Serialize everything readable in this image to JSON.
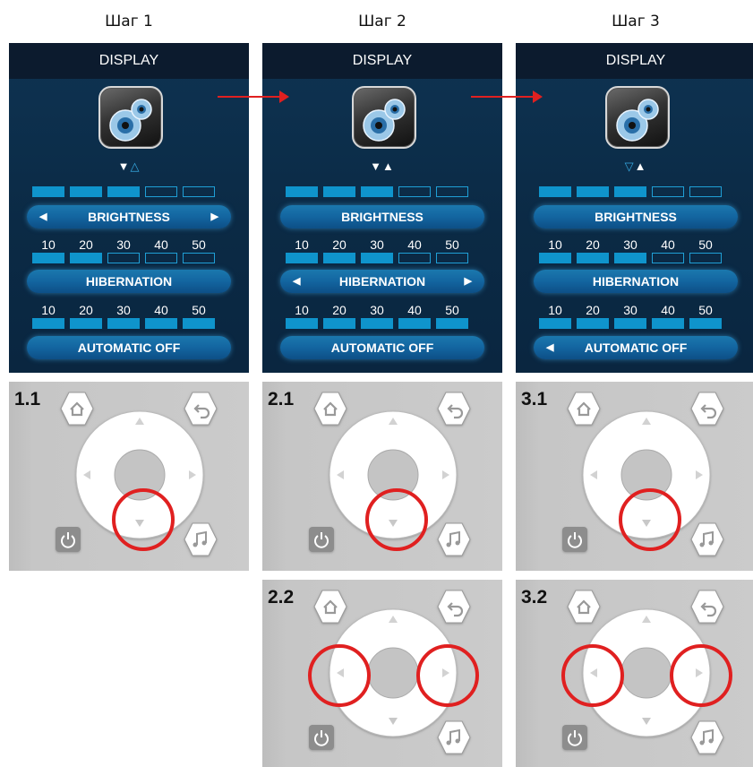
{
  "steps": [
    {
      "title": "Шаг 1",
      "screen": {
        "header": "DISPLAY",
        "arrow_left": "▼",
        "arrow_right": "△",
        "brightness": {
          "label": "BRIGHTNESS",
          "selected": true,
          "level": 3,
          "total": 5
        },
        "hibernation": {
          "label": "HIBERNATION",
          "selected": false,
          "level": 2,
          "total": 5,
          "values": [
            "10",
            "20",
            "30",
            "40",
            "50"
          ]
        },
        "automatic_off": {
          "label": "AUTOMATIC OFF",
          "selected": false,
          "level": 5,
          "total": 5,
          "values": [
            "10",
            "20",
            "30",
            "40",
            "50"
          ]
        }
      },
      "pads": [
        {
          "label": "1.1",
          "highlight": "down"
        }
      ]
    },
    {
      "title": "Шаг 2",
      "screen": {
        "header": "DISPLAY",
        "arrow_left": "▼",
        "arrow_right": "▲",
        "brightness": {
          "label": "BRIGHTNESS",
          "selected": false,
          "level": 3,
          "total": 5
        },
        "hibernation": {
          "label": "HIBERNATION",
          "selected": true,
          "level": 3,
          "total": 5,
          "values": [
            "10",
            "20",
            "30",
            "40",
            "50"
          ]
        },
        "automatic_off": {
          "label": "AUTOMATIC OFF",
          "selected": false,
          "level": 5,
          "total": 5,
          "values": [
            "10",
            "20",
            "30",
            "40",
            "50"
          ]
        }
      },
      "pads": [
        {
          "label": "2.1",
          "highlight": "down"
        },
        {
          "label": "2.2",
          "highlight": "left-right"
        }
      ]
    },
    {
      "title": "Шаг 3",
      "screen": {
        "header": "DISPLAY",
        "arrow_left": "▽",
        "arrow_right": "▲",
        "brightness": {
          "label": "BRIGHTNESS",
          "selected": false,
          "level": 3,
          "total": 5
        },
        "hibernation": {
          "label": "HIBERNATION",
          "selected": false,
          "level": 3,
          "total": 5,
          "values": [
            "10",
            "20",
            "30",
            "40",
            "50"
          ]
        },
        "automatic_off": {
          "label": "AUTOMATIC OFF",
          "selected": true,
          "level": 5,
          "total": 5,
          "values": [
            "10",
            "20",
            "30",
            "40",
            "50"
          ]
        }
      },
      "pads": [
        {
          "label": "3.1",
          "highlight": "down"
        },
        {
          "label": "3.2",
          "highlight": "left-right"
        }
      ]
    }
  ],
  "colors": {
    "accent": "#0f94cc",
    "highlight_ring": "#e02020",
    "screen_bg": "#0b2a45"
  }
}
